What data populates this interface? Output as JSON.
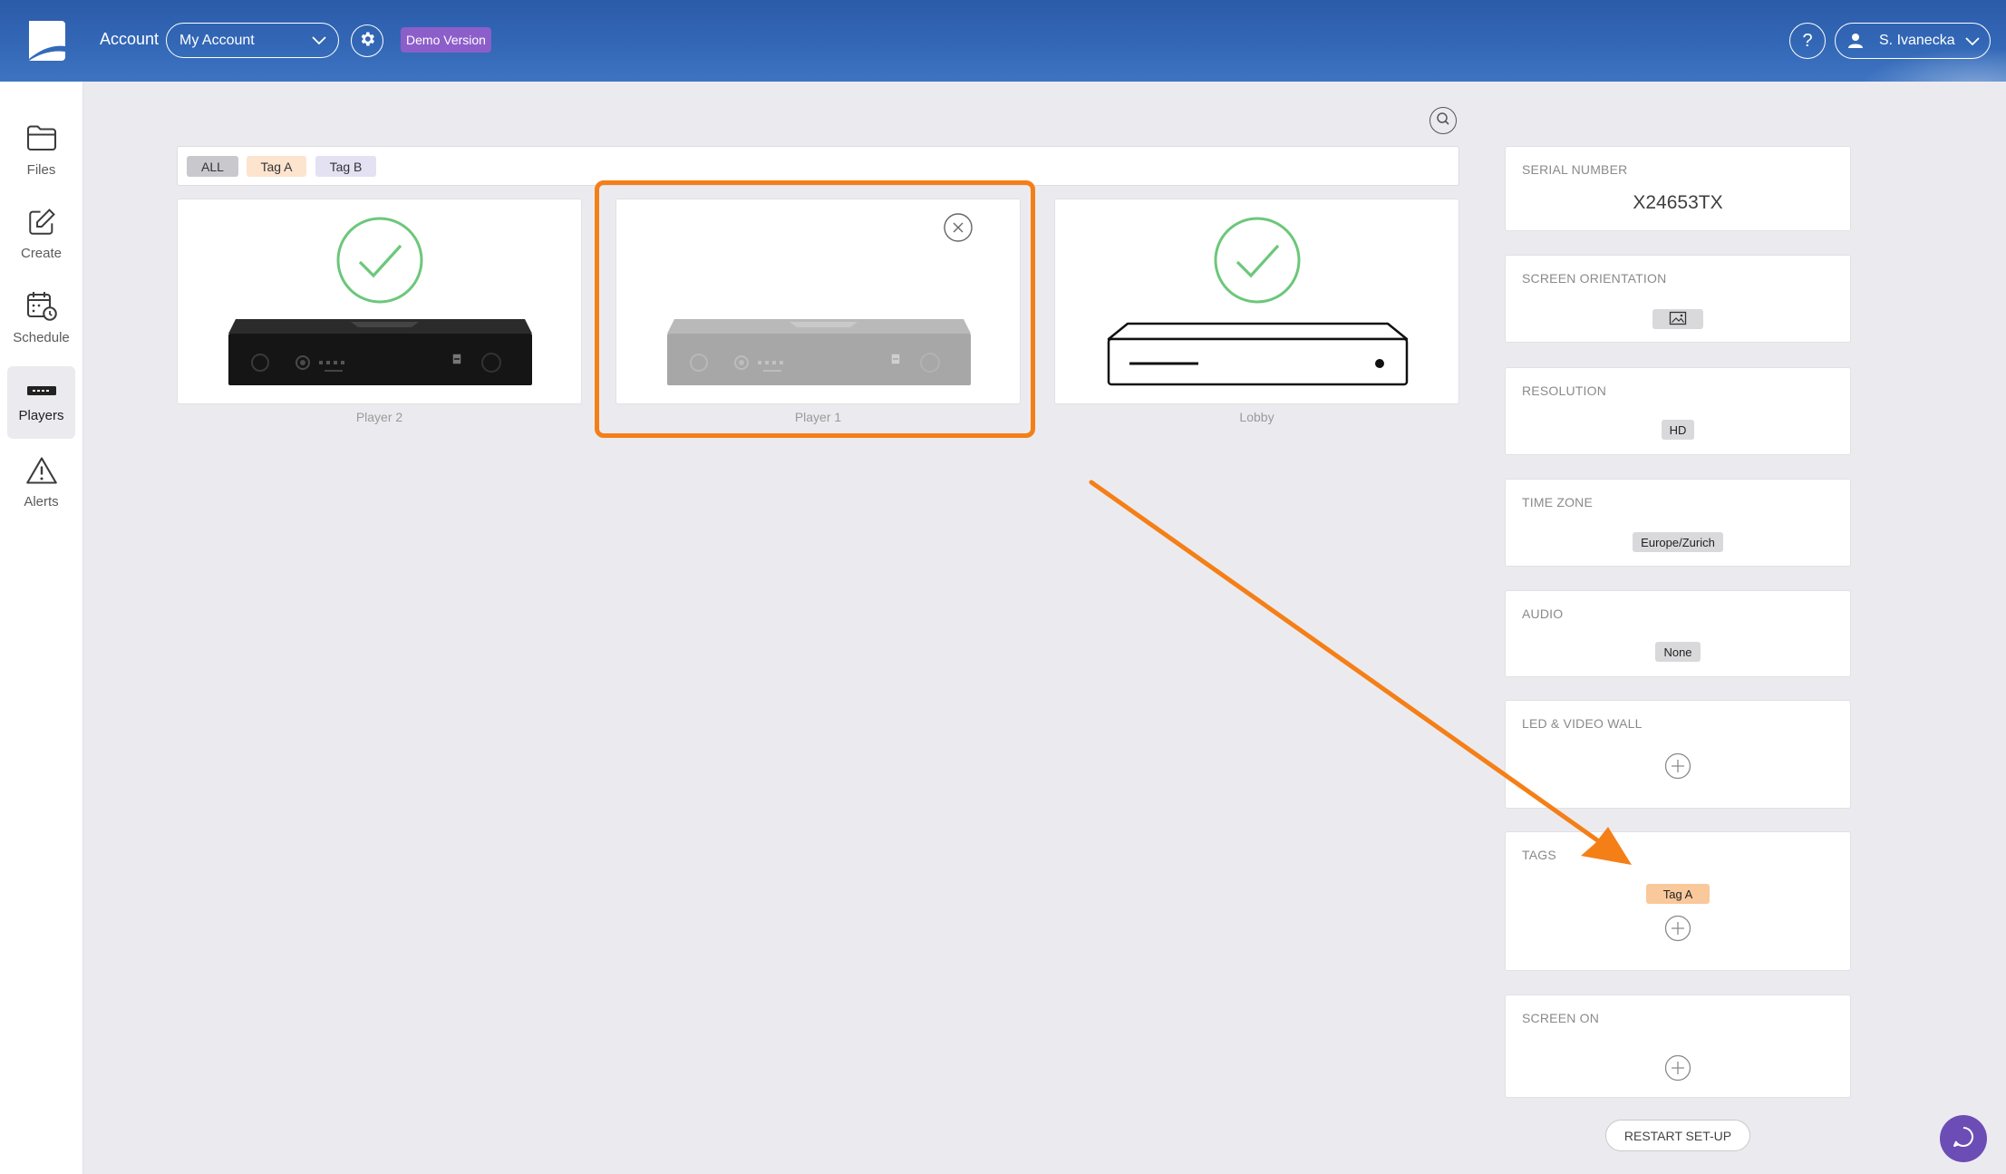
{
  "header": {
    "account_label": "Account",
    "account_selected": "My Account",
    "demo_badge": "Demo Version",
    "help_label": "?",
    "user_name": "S. Ivanecka",
    "logo_icon": "app-logo-icon",
    "settings_icon": "gear-icon",
    "user_icon": "user-icon"
  },
  "sidebar": {
    "items": [
      {
        "label": "Files",
        "icon": "folder-icon"
      },
      {
        "label": "Create",
        "icon": "edit-icon"
      },
      {
        "label": "Schedule",
        "icon": "calendar-clock-icon"
      },
      {
        "label": "Players",
        "icon": "player-device-icon",
        "active": true
      },
      {
        "label": "Alerts",
        "icon": "warning-icon"
      }
    ]
  },
  "filter_tags": [
    {
      "label": "ALL",
      "color": "#c9c9cd"
    },
    {
      "label": "Tag A",
      "color": "#fde4cf"
    },
    {
      "label": "Tag B",
      "color": "#e4e1f3"
    }
  ],
  "players": [
    {
      "name": "Player 2",
      "status_icon": "check-circle-icon",
      "device_icon": "media-player-black-icon"
    },
    {
      "name": "Player 1",
      "status_icon": "close-circle-icon",
      "device_icon": "media-player-grey-icon",
      "selected": true
    },
    {
      "name": "Lobby",
      "status_icon": "check-circle-icon",
      "device_icon": "media-player-outline-icon"
    }
  ],
  "details": {
    "serial_number": {
      "label": "SERIAL NUMBER",
      "value": "X24653TX"
    },
    "screen_orientation": {
      "label": "SCREEN ORIENTATION",
      "icon": "landscape-image-icon"
    },
    "resolution": {
      "label": "RESOLUTION",
      "value": "HD"
    },
    "time_zone": {
      "label": "TIME ZONE",
      "value": "Europe/Zurich"
    },
    "audio": {
      "label": "AUDIO",
      "value": "None"
    },
    "led_video_wall": {
      "label": "LED & VIDEO WALL",
      "add_icon": "plus-circle-icon"
    },
    "tags": {
      "label": "TAGS",
      "items": [
        "Tag A"
      ],
      "tag_color": "#f9c89b",
      "add_icon": "plus-circle-icon"
    },
    "screen_on": {
      "label": "SCREEN ON",
      "add_icon": "plus-circle-icon"
    },
    "restart_label": "RESTART SET-UP"
  },
  "colors": {
    "header": "#2f63b3",
    "background": "#ebebef",
    "status_ok": "#6cc77a",
    "annotation": "#f57f17",
    "demo_badge": "#8c5ec9",
    "chat": "#6c4db6"
  }
}
